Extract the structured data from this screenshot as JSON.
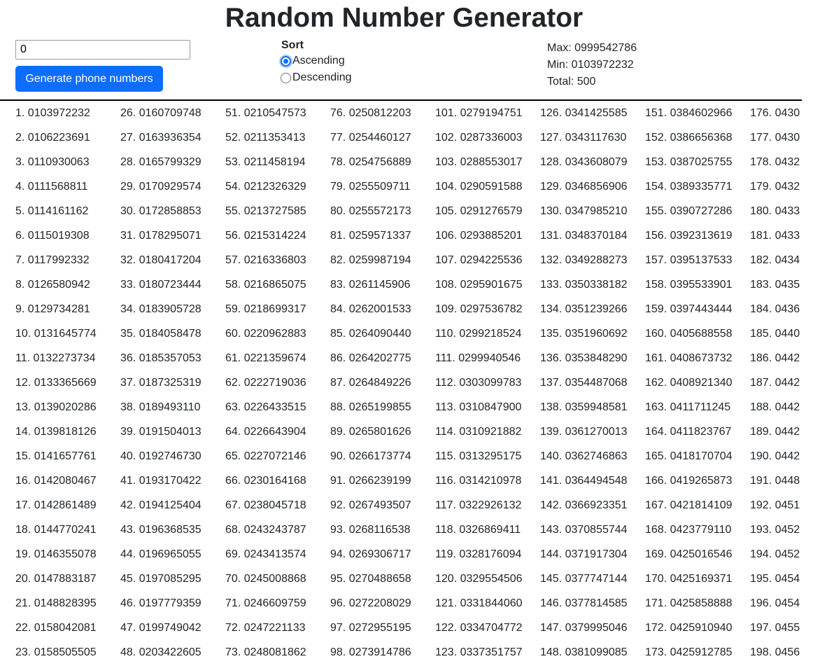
{
  "header": {
    "title": "Random Number Generator"
  },
  "controls": {
    "count_value": "0",
    "generate_label": "Generate phone numbers",
    "sort_label": "Sort",
    "sort_options": [
      {
        "label": "Ascending",
        "checked": true
      },
      {
        "label": "Descending",
        "checked": false
      }
    ]
  },
  "stats": {
    "max": "Max: 0999542786",
    "min": "Min: 0103972232",
    "total": "Total: 500"
  },
  "colors": {
    "accent": "#0d6efd",
    "divider": "#000000"
  },
  "numbers": [
    [
      "1. 0103972232",
      "2. 0106223691",
      "3. 0110930063",
      "4. 0111568811",
      "5. 0114161162",
      "6. 0115019308",
      "7. 0117992332",
      "8. 0126580942",
      "9. 0129734281",
      "10. 0131645774",
      "11. 0132273734",
      "12. 0133365669",
      "13. 0139020286",
      "14. 0139818126",
      "15. 0141657761",
      "16. 0142080467",
      "17. 0142861489",
      "18. 0144770241",
      "19. 0146355078",
      "20. 0147883187",
      "21. 0148828395",
      "22. 0158042081",
      "23. 0158505505"
    ],
    [
      "26. 0160709748",
      "27. 0163936354",
      "28. 0165799329",
      "29. 0170929574",
      "30. 0172858853",
      "31. 0178295071",
      "32. 0180417204",
      "33. 0180723444",
      "34. 0183905728",
      "35. 0184058478",
      "36. 0185357053",
      "37. 0187325319",
      "38. 0189493110",
      "39. 0191504013",
      "40. 0192746730",
      "41. 0193170422",
      "42. 0194125404",
      "43. 0196368535",
      "44. 0196965055",
      "45. 0197085295",
      "46. 0197779359",
      "47. 0199749042",
      "48. 0203422605"
    ],
    [
      "51. 0210547573",
      "52. 0211353413",
      "53. 0211458194",
      "54. 0212326329",
      "55. 0213727585",
      "56. 0215314224",
      "57. 0216336803",
      "58. 0216865075",
      "59. 0218699317",
      "60. 0220962883",
      "61. 0221359674",
      "62. 0222719036",
      "63. 0226433515",
      "64. 0226643904",
      "65. 0227072146",
      "66. 0230164168",
      "67. 0238045718",
      "68. 0243243787",
      "69. 0243413574",
      "70. 0245008868",
      "71. 0246609759",
      "72. 0247221133",
      "73. 0248081862"
    ],
    [
      "76. 0250812203",
      "77. 0254460127",
      "78. 0254756889",
      "79. 0255509711",
      "80. 0255572173",
      "81. 0259571337",
      "82. 0259987194",
      "83. 0261145906",
      "84. 0262001533",
      "85. 0264090440",
      "86. 0264202775",
      "87. 0264849226",
      "88. 0265199855",
      "89. 0265801626",
      "90. 0266173774",
      "91. 0266239199",
      "92. 0267493507",
      "93. 0268116538",
      "94. 0269306717",
      "95. 0270488658",
      "96. 0272208029",
      "97. 0272955195",
      "98. 0273914786"
    ],
    [
      "101. 0279194751",
      "102. 0287336003",
      "103. 0288553017",
      "104. 0290591588",
      "105. 0291276579",
      "106. 0293885201",
      "107. 0294225536",
      "108. 0295901675",
      "109. 0297536782",
      "110. 0299218524",
      "111. 0299940546",
      "112. 0303099783",
      "113. 0310847900",
      "114. 0310921882",
      "115. 0313295175",
      "116. 0314210978",
      "117. 0322926132",
      "118. 0326869411",
      "119. 0328176094",
      "120. 0329554506",
      "121. 0331844060",
      "122. 0334704772",
      "123. 0337351757"
    ],
    [
      "126. 0341425585",
      "127. 0343117630",
      "128. 0343608079",
      "129. 0346856906",
      "130. 0347985210",
      "131. 0348370184",
      "132. 0349288273",
      "133. 0350338182",
      "134. 0351239266",
      "135. 0351960692",
      "136. 0353848290",
      "137. 0354487068",
      "138. 0359948581",
      "139. 0361270013",
      "140. 0362746863",
      "141. 0364494548",
      "142. 0366923351",
      "143. 0370855744",
      "144. 0371917304",
      "145. 0377747144",
      "146. 0377814585",
      "147. 0379995046",
      "148. 0381099085"
    ],
    [
      "151. 0384602966",
      "152. 0386656368",
      "153. 0387025755",
      "154. 0389335771",
      "155. 0390727286",
      "156. 0392313619",
      "157. 0395137533",
      "158. 0395533901",
      "159. 0397443444",
      "160. 0405688558",
      "161. 0408673732",
      "162. 0408921340",
      "163. 0411711245",
      "164. 0411823767",
      "165. 0418170704",
      "166. 0419265873",
      "167. 0421814109",
      "168. 0423779110",
      "169. 0425016546",
      "170. 0425169371",
      "171. 0425858888",
      "172. 0425910940",
      "173. 0425912785"
    ],
    [
      "176. 0430",
      "177. 0430",
      "178. 0432",
      "179. 0432",
      "180. 0433",
      "181. 0433",
      "182. 0434",
      "183. 0435",
      "184. 0436",
      "185. 0440",
      "186. 0442",
      "187. 0442",
      "188. 0442",
      "189. 0442",
      "190. 0442",
      "191. 0448",
      "192. 0451",
      "193. 0452",
      "194. 0452",
      "195. 0454",
      "196. 0454",
      "197. 0455",
      "198. 0456"
    ]
  ]
}
